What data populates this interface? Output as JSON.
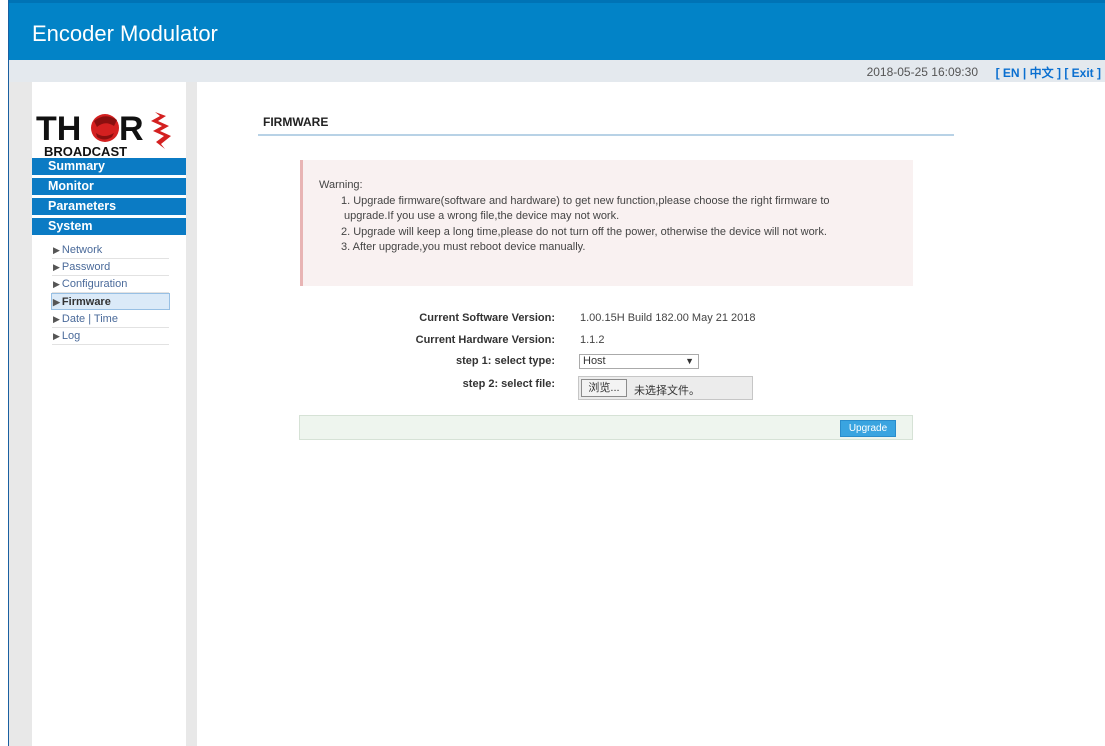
{
  "app": {
    "title": "Encoder Modulator"
  },
  "header": {
    "datetime": "2018-05-25 16:09:30",
    "lang_en": "[ EN |",
    "lang_zh": "中文 ]",
    "exit": "[ Exit ]"
  },
  "logo": {
    "brand": "THOR",
    "sub": "BROADCAST"
  },
  "sidebar": {
    "menu": [
      {
        "label": "Summary"
      },
      {
        "label": "Monitor"
      },
      {
        "label": "Parameters"
      },
      {
        "label": "System"
      }
    ],
    "submenu": [
      {
        "label": "Network"
      },
      {
        "label": "Password"
      },
      {
        "label": "Configuration"
      },
      {
        "label": "Firmware",
        "active": true
      },
      {
        "label": "Date | Time"
      },
      {
        "label": "Log"
      }
    ]
  },
  "page": {
    "heading": "FIRMWARE",
    "warning": {
      "title": "Warning:",
      "line1": "1. Upgrade firmware(software and hardware) to get new function,please choose the right firmware to",
      "line1b": "upgrade.If you use a wrong file,the device may not work.",
      "line2": "2. Upgrade will keep a long time,please do not turn off the power, otherwise the device will not work.",
      "line3": "3. After upgrade,you must reboot device manually."
    },
    "form": {
      "software_label": "Current Software Version:",
      "software_value": "1.00.15H Build 182.00 May 21 2018",
      "hardware_label": "Current Hardware Version:",
      "hardware_value": "1.1.2",
      "type_label": "step 1: select type:",
      "type_value": "Host",
      "file_label": "step 2: select file:",
      "browse_label": "浏览...",
      "file_status": "未选择文件。"
    },
    "upgrade_label": "Upgrade"
  },
  "colors": {
    "header_blue": "#0283c7",
    "menu_blue": "#0b7bc4",
    "button_blue": "#3aa4e0"
  }
}
